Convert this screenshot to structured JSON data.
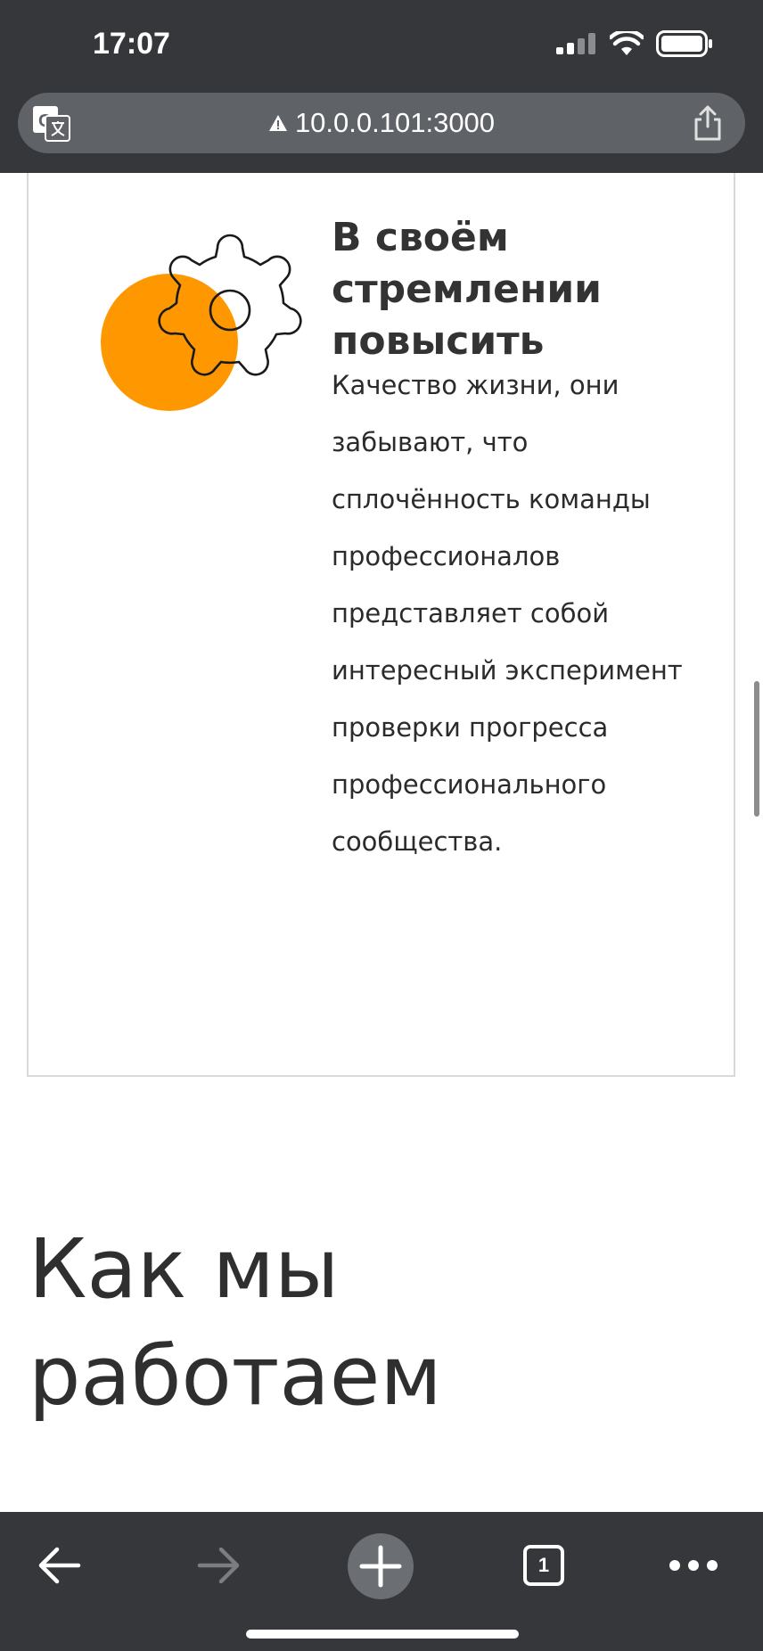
{
  "status_bar": {
    "time": "17:07",
    "icons": [
      "signal-icon",
      "wifi-icon",
      "battery-icon"
    ]
  },
  "browser": {
    "url": "10.0.0.101:3000",
    "security": "warning-icon",
    "tab_count": "1"
  },
  "card": {
    "title": "В своём стремлении повысить",
    "text": "Качество жизни, они забывают, что сплочённость команды профессионалов представляет собой интересный эксперимент проверки прогресса профессионального сообщества.",
    "illustration": [
      "orange-circle",
      "gear-icon"
    ],
    "accent_color": "#FF9800"
  },
  "section": {
    "title": "Как мы работаем"
  },
  "toolbar": {
    "buttons": [
      "back-arrow-icon",
      "forward-arrow-icon",
      "new-tab-plus-icon",
      "tabs-icon",
      "more-icon"
    ]
  }
}
